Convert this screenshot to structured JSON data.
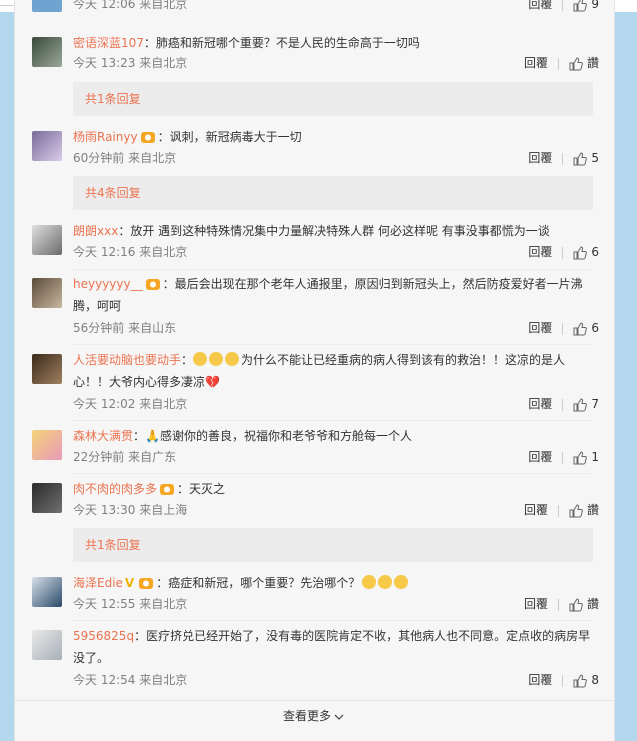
{
  "partial_top": {
    "meta": "今天 12:06 来自北京",
    "reply": "回覆",
    "likes": "9"
  },
  "comments": [
    {
      "name": "密语深蓝107",
      "text": "：肺癌和新冠哪个重要？不是人民的生命高于一切吗",
      "meta": "今天 13:23 来自北京",
      "reply": "回覆",
      "likes": "讚",
      "replies": "共1条回复"
    },
    {
      "name": "杨雨Rainyy",
      "text": "：讽刺，新冠病毒大于一切",
      "meta": "60分钟前 来自北京",
      "reply": "回覆",
      "likes": "5",
      "replies": "共4条回复"
    },
    {
      "name": "朗朗xxx",
      "text": "：放开 遇到这种特殊情况集中力量解决特殊人群 何必这样呢 有事没事都慌为一谈",
      "meta": "今天 12:16 来自北京",
      "reply": "回覆",
      "likes": "6"
    },
    {
      "name": "heyyyyyy__",
      "text": "：最后会出现在那个老年人通报里，原因归到新冠头上，然后防疫爱好者一片沸",
      "text2": "腾，呵呵",
      "meta": "56分钟前 来自山东",
      "reply": "回覆",
      "likes": "6"
    },
    {
      "name": "人活要动脑也要动手",
      "text": "为什么不能让已经重病的病人得到该有的救治！！这凉的是人",
      "text2": "心！！大爷内心得多凄凉",
      "meta": "今天 12:02 来自北京",
      "reply": "回覆",
      "likes": "7"
    },
    {
      "name": "森林大满贯",
      "text": "感谢你的善良，祝福你和老爷爷和方舱每一个人",
      "meta": "22分钟前 来自广东",
      "reply": "回覆",
      "likes": "1"
    },
    {
      "name": "肉不肉的肉多多",
      "text": "：天灭之",
      "meta": "今天 13:30 来自上海",
      "reply": "回覆",
      "likes": "讚",
      "replies": "共1条回复"
    },
    {
      "name": "海泽Edie",
      "text": "：癌症和新冠，哪个重要？先治哪个？",
      "meta": "今天 12:55 来自北京",
      "reply": "回覆",
      "likes": "讚"
    },
    {
      "name": "5956825q",
      "text": "：医疗挤兑已经开始了，没有毒的医院肯定不收，其他病人也不同意。定点收的病房早",
      "text2": "没了。",
      "meta": "今天 12:54 来自北京",
      "reply": "回覆",
      "likes": "8"
    }
  ],
  "more_label": "查看更多",
  "colors": {
    "name": "#eb7350",
    "meta": "#808080",
    "panel": "#f6f6f6",
    "page": "#b3d8ee"
  }
}
